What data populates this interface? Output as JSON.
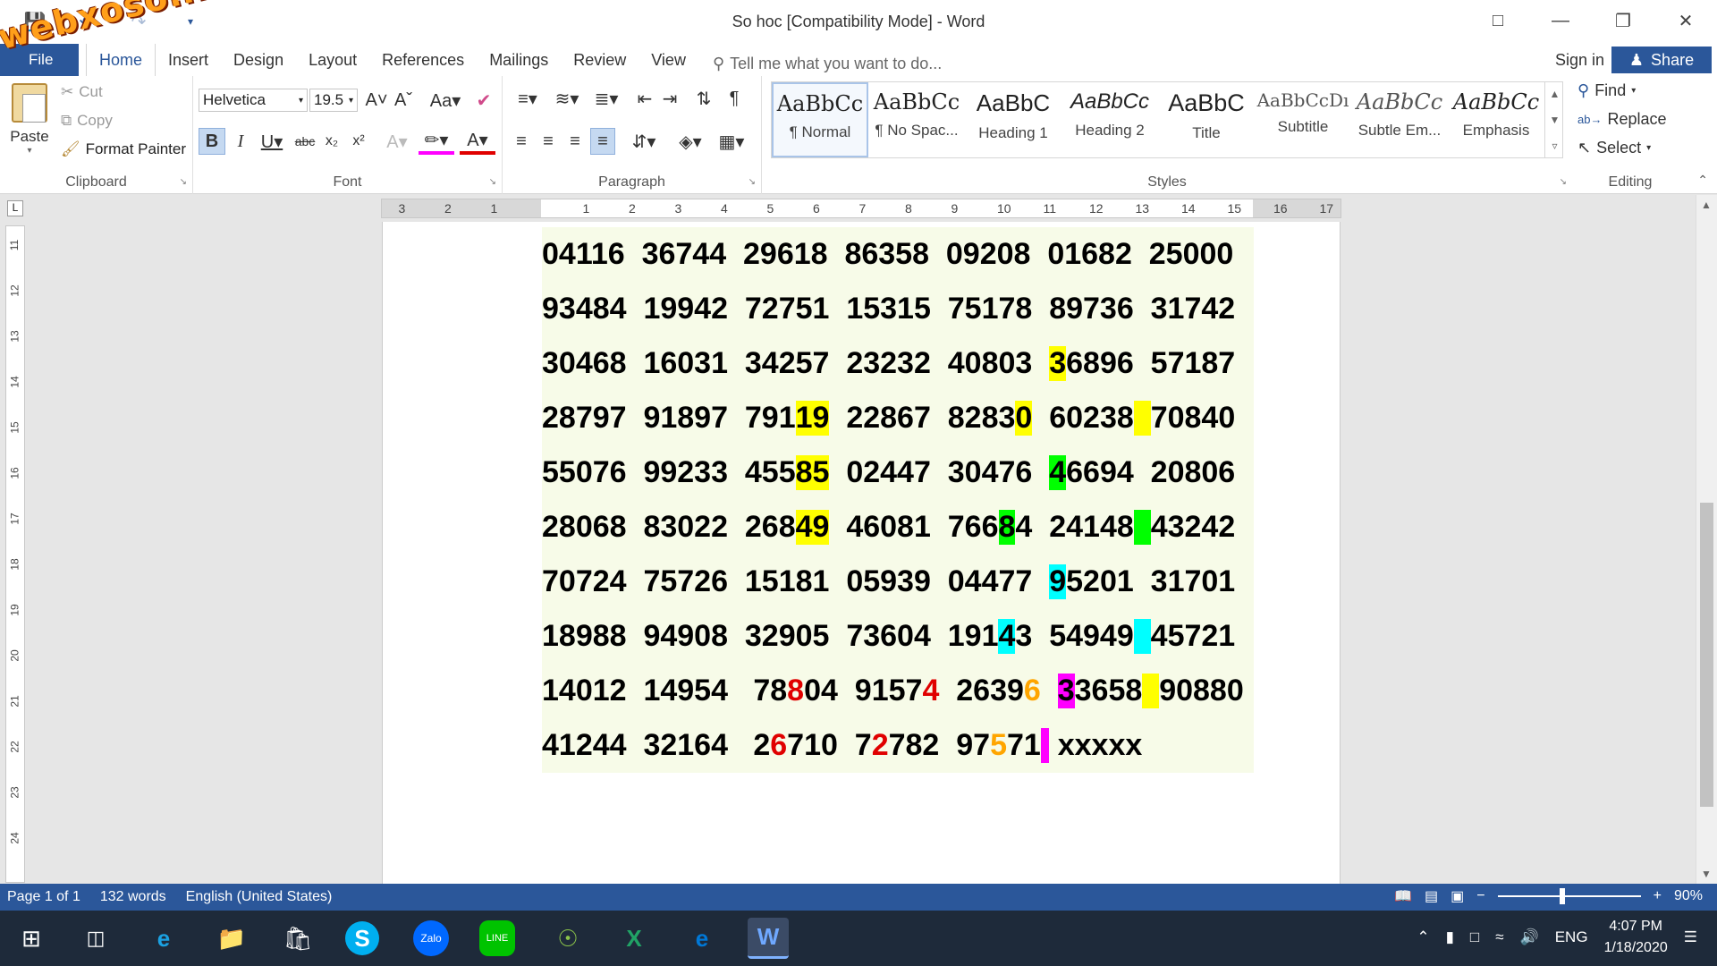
{
  "window": {
    "title": "So hoc [Compatibility Mode] - Word",
    "watermark": "webxoso.net"
  },
  "tabs": {
    "file": "File",
    "items": [
      "Home",
      "Insert",
      "Design",
      "Layout",
      "References",
      "Mailings",
      "Review",
      "View"
    ],
    "active": "Home",
    "tell_me": "Tell me what you want to do...",
    "sign_in": "Sign in",
    "share": "Share"
  },
  "clipboard": {
    "paste": "Paste",
    "cut": "Cut",
    "copy": "Copy",
    "format_painter": "Format Painter",
    "label": "Clipboard"
  },
  "font": {
    "family": "Helvetica",
    "size": "19.5",
    "label": "Font"
  },
  "paragraph": {
    "label": "Paragraph"
  },
  "styles": {
    "label": "Styles",
    "items": [
      {
        "sample": "AaBbCc",
        "name": "¶ Normal"
      },
      {
        "sample": "AaBbCc",
        "name": "¶ No Spac..."
      },
      {
        "sample": "AaBbC",
        "name": "Heading 1"
      },
      {
        "sample": "AaBbCc",
        "name": "Heading 2"
      },
      {
        "sample": "AaBbC",
        "name": "Title"
      },
      {
        "sample": "AaBbCcDı",
        "name": "Subtitle"
      },
      {
        "sample": "AaBbCc",
        "name": "Subtle Em..."
      },
      {
        "sample": "AaBbCc",
        "name": "Emphasis"
      }
    ]
  },
  "editing": {
    "find": "Find",
    "replace": "Replace",
    "select": "Select",
    "label": "Editing"
  },
  "ruler": {
    "numbers": [
      "3",
      "2",
      "1",
      "1",
      "2",
      "3",
      "4",
      "5",
      "6",
      "7",
      "8",
      "9",
      "10",
      "11",
      "12",
      "13",
      "14",
      "15",
      "16",
      "17"
    ],
    "vertical": [
      "11",
      "12",
      "13",
      "14",
      "15",
      "16",
      "17",
      "18",
      "19",
      "20",
      "21",
      "22",
      "23",
      "24"
    ]
  },
  "document": {
    "lines": [
      "04116  36744  29618  86358  09208  01682  25000",
      "93484  19942  72751  15315  75178  89736  31742",
      "30468  16031  34257  23232  40803  36896  57187",
      "28797  91897  79119  22867  82830  60238  70840",
      "55076  99233  45585  02447  30476  46694  20806",
      "28068  83022  26849  46081  76684  24148  43242",
      "70724  75726  15181  05939  04477  95201  31701",
      "18988  94908  32905  73604  19143  54949  45721",
      "14012  14954   78804  91574  26396  33658  90880",
      "41244  32164   26710  72782  97571  xxxxx"
    ]
  },
  "status": {
    "page": "Page 1 of 1",
    "words": "132 words",
    "language": "English (United States)",
    "zoom": "90%",
    "zoom_fraction": 0.45
  },
  "taskbar": {
    "time": "4:07 PM",
    "date": "1/18/2020",
    "lang": "ENG",
    "apps": [
      "start",
      "task-view",
      "internet-explorer",
      "file-explorer",
      "store",
      "skype",
      "zalo",
      "line",
      "ultraviewer",
      "excel",
      "edge",
      "word"
    ]
  },
  "colors": {
    "accent": "#2b579a",
    "highlight_yellow": "#ffff00",
    "highlight_green": "#00ff00",
    "highlight_cyan": "#00ffff",
    "highlight_magenta": "#ff00ff",
    "text_red": "#e00000",
    "text_orange": "#ffa500"
  }
}
